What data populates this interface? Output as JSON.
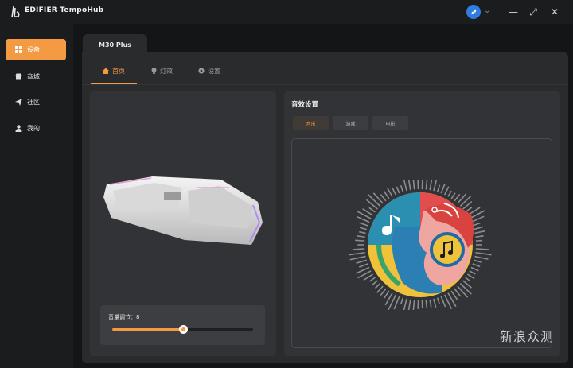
{
  "app": {
    "title": "EDIFIER TempoHub"
  },
  "window": {
    "minimize": "—",
    "maximize": "⤢",
    "close": "✕"
  },
  "sidebar": {
    "items": [
      {
        "label": "设备",
        "icon": "grid-icon",
        "active": true
      },
      {
        "label": "商城",
        "icon": "shop-icon",
        "active": false
      },
      {
        "label": "社区",
        "icon": "send-icon",
        "active": false
      },
      {
        "label": "我的",
        "icon": "user-icon",
        "active": false
      }
    ]
  },
  "device": {
    "name": "M30 Plus"
  },
  "tabs": [
    {
      "label": "首页",
      "icon": "home-icon",
      "active": true
    },
    {
      "label": "灯效",
      "icon": "bulb-icon",
      "active": false
    },
    {
      "label": "设置",
      "icon": "gear-icon",
      "active": false
    }
  ],
  "volume": {
    "label": "音量调节：8",
    "level": 0.5
  },
  "eq": {
    "title": "音效设置",
    "modes": [
      {
        "label": "音乐",
        "active": true
      },
      {
        "label": "游戏",
        "active": false
      },
      {
        "label": "电影",
        "active": false
      }
    ]
  },
  "watermark": "新浪众测",
  "colors": {
    "accent": "#f49a43",
    "panel": "#2a2b2d",
    "card": "#323336"
  }
}
